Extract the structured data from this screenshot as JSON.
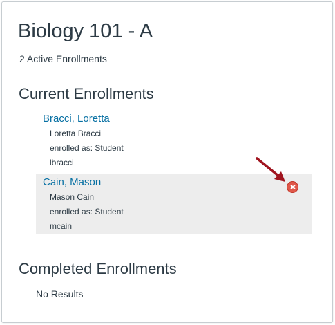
{
  "course": {
    "title": "Biology 101 - A",
    "enrollment_count": "2 Active Enrollments"
  },
  "current_enrollments": {
    "heading": "Current Enrollments",
    "items": [
      {
        "name_link": "Bracci, Loretta",
        "full_name": "Loretta Bracci",
        "role": "enrolled as: Student",
        "login": "lbracci"
      },
      {
        "name_link": "Cain, Mason",
        "full_name": "Mason Cain",
        "role": "enrolled as: Student",
        "login": "mcain",
        "remove_icon": "remove-circle-x-icon"
      }
    ]
  },
  "completed_enrollments": {
    "heading": "Completed Enrollments",
    "empty_text": "No Results"
  },
  "colors": {
    "link": "#0770a3",
    "text": "#2d3b45",
    "highlight_row": "#ededed",
    "remove_icon": "#e0584a",
    "annotation_arrow": "#a0141f"
  }
}
